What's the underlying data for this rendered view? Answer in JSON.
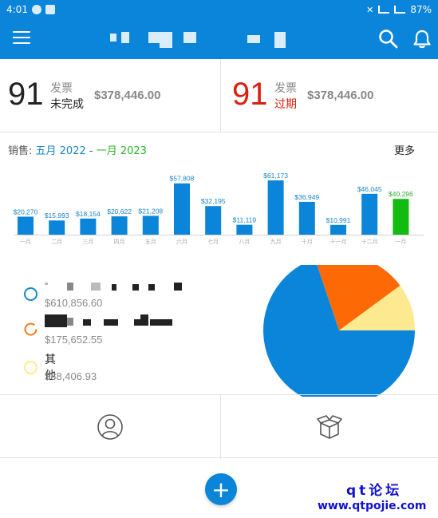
{
  "status_bar": {
    "time": "4:01",
    "battery": "87%"
  },
  "summary": {
    "incomplete": {
      "count": "91",
      "label_top": "发票",
      "label_bottom": "未完成",
      "amount": "$378,446.00"
    },
    "overdue": {
      "count": "91",
      "label_top": "发票",
      "label_bottom": "过期",
      "amount": "$378,446.00"
    }
  },
  "sales": {
    "prefix": "销售: ",
    "range_start": "五月 2022",
    "separator": " - ",
    "range_end": "一月 2023",
    "more_label": "更多"
  },
  "colors": {
    "brand": "#0a85d9",
    "bar": "#0a85d9",
    "bar_current": "#11bb11",
    "overdue": "#d92010",
    "pie_orange": "#fd6a05",
    "pie_yellow": "#fde98f"
  },
  "chart_data": {
    "type": "bar",
    "categories": [
      "一月",
      "二月",
      "三月",
      "四月",
      "五月",
      "六月",
      "七月",
      "八月",
      "九月",
      "十月",
      "十一月",
      "十二月",
      "一月"
    ],
    "data_labels": [
      "$20,270",
      "$15,993",
      "$18,154",
      "$20,622",
      "$21,208",
      "$57,808",
      "$32,195",
      "$11,119",
      "$61,173",
      "$36,949",
      "$10,991",
      "$46,045",
      "$40,296"
    ],
    "values": [
      20270,
      15993,
      18154,
      20622,
      21208,
      57808,
      32195,
      11119,
      61173,
      36949,
      10991,
      46045,
      40296
    ],
    "highlight_index": 12,
    "ylim": [
      0,
      61173
    ]
  },
  "legend": {
    "items": [
      {
        "value": "$610,856.60",
        "color": "#1a86c8"
      },
      {
        "value": "$175,652.55",
        "color": "#f07a1a"
      },
      {
        "name": "其他",
        "value": "$88,406.93",
        "color": "#fde98f"
      }
    ]
  },
  "pie_data": {
    "type": "pie",
    "values": [
      610856.6,
      175652.55,
      88406.93
    ],
    "colors": [
      "#0a85d9",
      "#fd6a05",
      "#fde98f"
    ]
  },
  "fab": {
    "label": "+"
  },
  "watermark": {
    "line1": "qt论坛",
    "line2": "www.qtpojie.com"
  },
  "icons": {
    "menu": "menu-icon",
    "search": "search-icon",
    "bell": "bell-icon",
    "contacts": "person-circle-icon",
    "items": "box-icon"
  }
}
